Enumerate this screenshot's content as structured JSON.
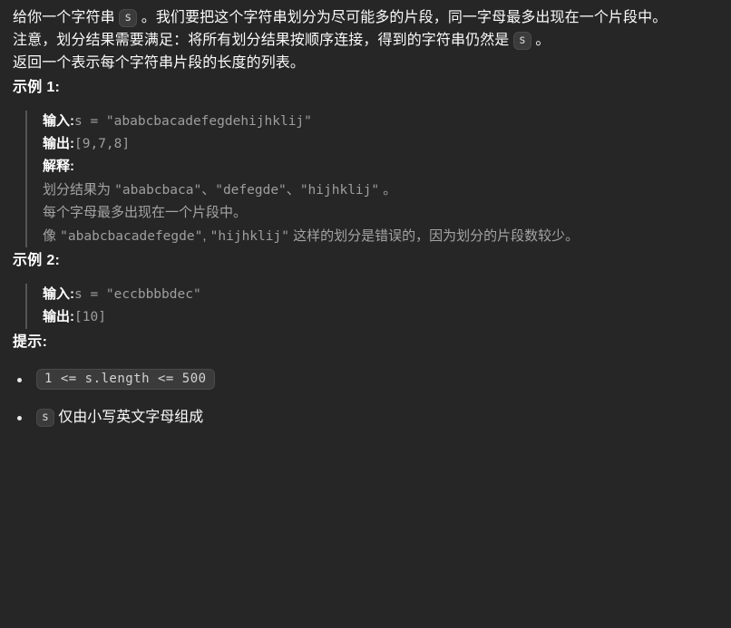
{
  "problem": {
    "paragraphs": [
      {
        "id": "p1",
        "before": "给你一个字符串 ",
        "code": "s",
        "after": " 。我们要把这个字符串划分为尽可能多的片段，同一字母最多出现在一个片段中。"
      },
      {
        "id": "p2",
        "before": "注意，划分结果需要满足：将所有划分结果按顺序连接，得到的字符串仍然是 ",
        "code": "s",
        "after": " 。"
      },
      {
        "id": "p3",
        "text": "返回一个表示每个字符串片段的长度的列表。"
      }
    ],
    "examples": [
      {
        "heading": "示例 1:",
        "input_label": "输入:",
        "input_value": "s = \"ababcbacadefegdehijhklij\"",
        "output_label": "输出:",
        "output_value": "[9,7,8]",
        "explanation_label": "解释:",
        "explanation_lines": [
          {
            "segments": [
              {
                "type": "text",
                "value": "划分结果为 "
              },
              {
                "type": "mono",
                "value": "\"ababcbaca\""
              },
              {
                "type": "text",
                "value": "、"
              },
              {
                "type": "mono",
                "value": "\"defegde\""
              },
              {
                "type": "text",
                "value": "、"
              },
              {
                "type": "mono",
                "value": "\"hijhklij\""
              },
              {
                "type": "text",
                "value": " 。"
              }
            ]
          },
          {
            "segments": [
              {
                "type": "text",
                "value": "每个字母最多出现在一个片段中。"
              }
            ]
          },
          {
            "segments": [
              {
                "type": "text",
                "value": "像 "
              },
              {
                "type": "mono",
                "value": "\"ababcbacadefegde\""
              },
              {
                "type": "text",
                "value": ", "
              },
              {
                "type": "mono",
                "value": "\"hijhklij\""
              },
              {
                "type": "text",
                "value": " 这样的划分是错误的，因为划分的片段数较少。"
              }
            ]
          }
        ]
      },
      {
        "heading": "示例 2:",
        "input_label": "输入:",
        "input_value": "s = \"eccbbbbdec\"",
        "output_label": "输出:",
        "output_value": "[10]",
        "explanation_label": null,
        "explanation_lines": []
      }
    ],
    "hints": {
      "heading": "提示:",
      "items": [
        {
          "code": "1 <= s.length <= 500",
          "text": ""
        },
        {
          "code": "s",
          "text": " 仅由小写英文字母组成"
        }
      ]
    }
  },
  "theme": {
    "background": "#262626",
    "text": "#fafafa",
    "muted_text": "#a3a3a3",
    "code_text": "#9e9e9e",
    "code_badge_bg": "#3b3b3b",
    "code_badge_border": "#4a4a4a",
    "quote_bar": "#555555"
  }
}
